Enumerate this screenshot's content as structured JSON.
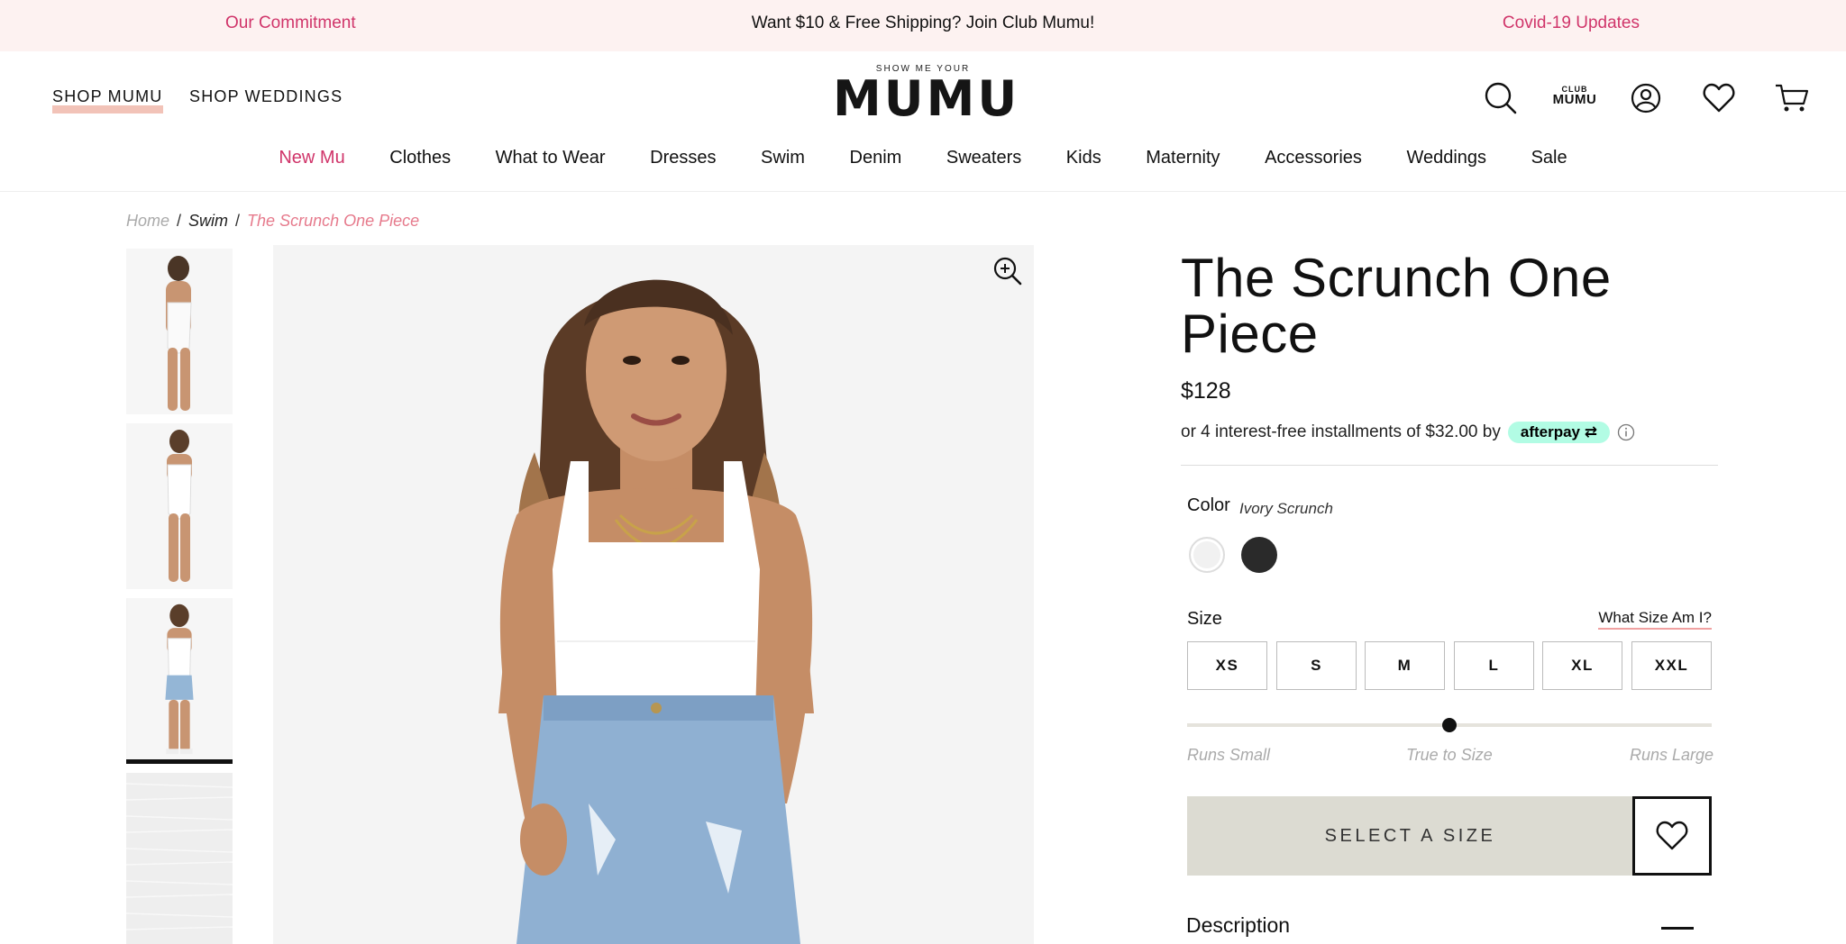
{
  "promo": {
    "left": "Our Commitment",
    "center": "Want $10 & Free Shipping? Join Club Mumu!",
    "right": "Covid-19 Updates"
  },
  "header": {
    "shop_mumu": "SHOP MUMU",
    "shop_weddings": "SHOP WEDDINGS",
    "logo_small": "SHOW ME YOUR",
    "logo_big": "MUMU",
    "club_small": "CLUB",
    "club_big": "MUMU",
    "icons": [
      "search-icon",
      "club-mumu-icon",
      "account-icon",
      "wishlist-heart-icon",
      "cart-icon"
    ]
  },
  "nav": [
    "New Mu",
    "Clothes",
    "What to Wear",
    "Dresses",
    "Swim",
    "Denim",
    "Sweaters",
    "Kids",
    "Maternity",
    "Accessories",
    "Weddings",
    "Sale"
  ],
  "breadcrumb": {
    "home": "Home",
    "sep": "/",
    "category": "Swim",
    "current": "The Scrunch One Piece"
  },
  "product": {
    "title": "The Scrunch One Piece",
    "price": "$128",
    "installments": "or 4 interest-free installments of $32.00 by",
    "afterpay": "afterpay",
    "color_label": "Color",
    "color_value": "Ivory Scrunch",
    "swatches": [
      "#f1f1f1",
      "#2a2a2a"
    ],
    "size_label": "Size",
    "size_guide": "What Size Am I?",
    "sizes": [
      "XS",
      "S",
      "M",
      "L",
      "XL",
      "XXL"
    ],
    "fit_labels": [
      "Runs Small",
      "True to Size",
      "Runs Large"
    ],
    "fit_value": 0.5,
    "cta": "SELECT A SIZE",
    "description_label": "Description"
  },
  "colors": {
    "accent_pink": "#d0356a",
    "promo_bg": "#fdf2f1",
    "afterpay_mint": "#b2fce4",
    "cta_bg": "#dcdbd2"
  }
}
